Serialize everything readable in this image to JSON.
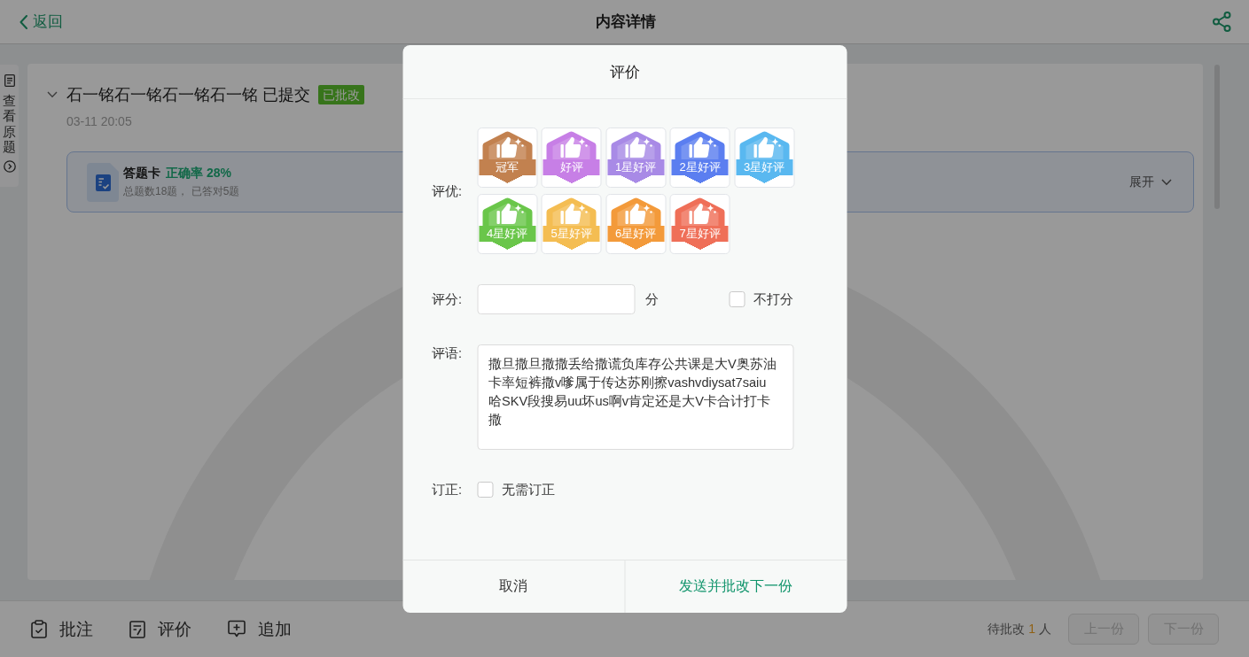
{
  "header": {
    "back": "返回",
    "title": "内容详情"
  },
  "side_tab": {
    "label": "查看原题"
  },
  "submission": {
    "title": "石一铭石一铭石一铭石一铭 已提交",
    "status": "已批改",
    "time": "03-11 20:05"
  },
  "answer_card": {
    "title": "答题卡",
    "accuracy": "正确率 28%",
    "summary": "总题数18题， 已答对5题",
    "toggle": "展开"
  },
  "toolbar": {
    "actions": [
      {
        "kind": "annotate",
        "label": "批注"
      },
      {
        "kind": "review",
        "label": "评价"
      },
      {
        "kind": "append",
        "label": "追加"
      }
    ],
    "pending": {
      "label": "待批改",
      "count": "1",
      "unit": "人"
    },
    "nav_buttons": [
      {
        "label": "上一份",
        "disabled": true
      },
      {
        "label": "下一份",
        "disabled": true
      }
    ]
  },
  "dialog": {
    "title": "评价",
    "award_label": "评优:",
    "awards": [
      {
        "label": "冠军",
        "color": "#c2814f",
        "selected": false
      },
      {
        "label": "好评",
        "color": "#c77fe6",
        "selected": false
      },
      {
        "label": "1星好评",
        "color": "#a88ae6",
        "selected": false
      },
      {
        "label": "2星好评",
        "color": "#5b7ef0",
        "selected": false
      },
      {
        "label": "3星好评",
        "color": "#59b8f0",
        "selected": false
      },
      {
        "label": "4星好评",
        "color": "#6ac64a",
        "selected": false
      },
      {
        "label": "5星好评",
        "color": "#f4bd52",
        "selected": false
      },
      {
        "label": "6星好评",
        "color": "#f39a3a",
        "selected": false
      },
      {
        "label": "7星好评",
        "color": "#ef6f58",
        "selected": false
      }
    ],
    "score_label": "评分:",
    "score_unit": "分",
    "no_score": {
      "label": "不打分",
      "checked": false
    },
    "comment_label": "评语:",
    "comment": "撒旦撒旦撒撒丢给撒谎负库存公共课是大V奥苏油卡率短裤撒v嗲属于传达苏刚擦vashvdiysat7saiu哈SKV段搜易uu坏us啊v肯定还是大V卡合计打卡撒",
    "correction_label": "订正:",
    "no_correction": {
      "label": "无需订正",
      "checked": false
    },
    "buttons": [
      {
        "kind": "cancel",
        "label": "取消"
      },
      {
        "kind": "confirm",
        "label": "发送并批改下一份"
      }
    ]
  }
}
